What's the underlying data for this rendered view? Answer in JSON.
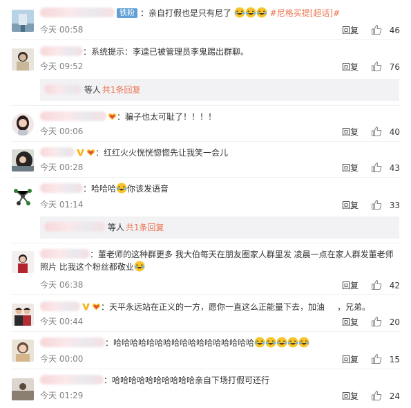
{
  "comments": [
    {
      "id": 1,
      "user_badge": "铁粉",
      "text_before": "：亲自打假也是只有尼了",
      "emoji_count": 3,
      "topic": "#尼格买提[超话]#",
      "time": "今天 00:58",
      "reply_label": "回复",
      "likes": "46"
    },
    {
      "id": 2,
      "text": "：系统提示：李逵已被管理员李鬼踢出群聊。",
      "time": "今天 09:52",
      "reply_label": "回复",
      "likes": "76",
      "sub_replies": {
        "label": "等人",
        "more": "共1条回复"
      }
    },
    {
      "id": 3,
      "text": "：骗子也太可耻了！！！！",
      "time": "今天 00:06",
      "reply_label": "回复",
      "likes": "40"
    },
    {
      "id": 4,
      "text": "：红红火火恍恍惚惚先让我笑一会儿",
      "time": "今天 00:28",
      "reply_label": "回复",
      "likes": "43"
    },
    {
      "id": 5,
      "text_before": "：哈哈哈",
      "text_after": "你该发语音",
      "time": "今天 01:14",
      "reply_label": "回复",
      "likes": "33",
      "sub_replies": {
        "label": "等人",
        "more": "共1条回复"
      }
    },
    {
      "id": 6,
      "text": "：董老师的这种群更多 我大伯每天在朋友圈家人群里发 凌晨一点在家人群发董老师照片 比我这个粉丝都敬业",
      "time": "今天 06:38",
      "reply_label": "回复",
      "likes": "42"
    },
    {
      "id": 7,
      "text_before": "：天平永远站在正义的一方，愿你一直这么正能量下去，加油",
      "text_after": "，兄弟。",
      "time": "今天 00:44",
      "reply_label": "回复",
      "likes": "20"
    },
    {
      "id": 8,
      "text": "：哈哈哈哈哈哈哈哈哈哈哈哈哈哈哈哈哈",
      "emoji_count": 5,
      "time": "今天 00:00",
      "reply_label": "回复",
      "likes": "15"
    },
    {
      "id": 9,
      "text": "：哈哈哈哈哈哈哈哈哈哈亲自下场打假可还行",
      "time": "今天 01:29",
      "reply_label": "回复",
      "likes": "24"
    }
  ],
  "colors": {
    "accent": "#eb7350",
    "badge": "#5f9fd6",
    "emoji": "#f7c52b"
  },
  "icons": {
    "like": "thumbs-up-icon",
    "emoji": "laughing-tears-emoji",
    "vip": "vip-v-icon",
    "fan_heart": "fan-heart-icon"
  }
}
